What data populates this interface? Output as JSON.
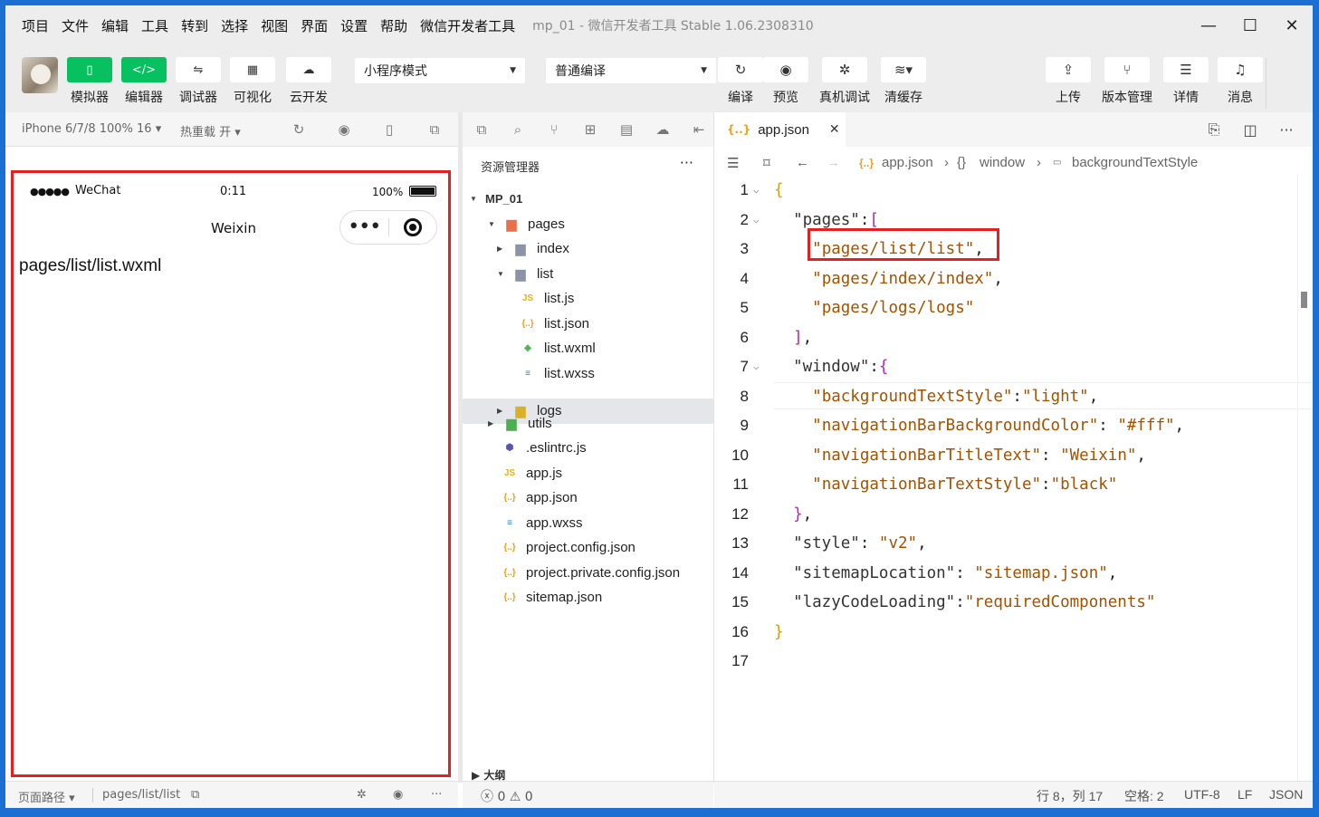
{
  "menu": [
    "项目",
    "文件",
    "编辑",
    "工具",
    "转到",
    "选择",
    "视图",
    "界面",
    "设置",
    "帮助",
    "微信开发者工具"
  ],
  "window_title": "mp_01 - 微信开发者工具 Stable 1.06.2308310",
  "window_controls": {
    "minimize": "—",
    "maximize": "☐",
    "close": "✕"
  },
  "toolbar": {
    "left": [
      {
        "label": "模拟器",
        "icon": "phone-icon",
        "glyph": "▯"
      },
      {
        "label": "编辑器",
        "icon": "code-icon",
        "glyph": "</>"
      },
      {
        "label": "调试器",
        "icon": "debug-icon",
        "glyph": "⇋"
      },
      {
        "label": "可视化",
        "icon": "layout-icon",
        "glyph": "▦"
      },
      {
        "label": "云开发",
        "icon": "cloud-icon",
        "glyph": "☁"
      }
    ],
    "mode_select": "小程序模式",
    "compile_select": "普通编译",
    "middle": [
      {
        "label": "编译",
        "icon": "refresh-icon",
        "glyph": "↻"
      },
      {
        "label": "预览",
        "icon": "eye-icon",
        "glyph": "◉"
      },
      {
        "label": "真机调试",
        "icon": "bug-icon",
        "glyph": "✲"
      },
      {
        "label": "清缓存",
        "icon": "layers-icon",
        "glyph": "≋▾"
      }
    ],
    "right": [
      {
        "label": "上传",
        "icon": "upload-icon",
        "glyph": "⇪"
      },
      {
        "label": "版本管理",
        "icon": "branch-icon",
        "glyph": "⑂"
      },
      {
        "label": "详情",
        "icon": "menu-icon",
        "glyph": "☰"
      },
      {
        "label": "消息",
        "icon": "bell-icon",
        "glyph": "♫"
      }
    ]
  },
  "simulator": {
    "device": "iPhone 6/7/8 100% 16 ▾",
    "hot_reload": "热重载 开 ▾",
    "status": {
      "signal": "●●●●●",
      "carrier": "WeChat",
      "time": "0:11",
      "battery": "100%"
    },
    "nav_title": "Weixin",
    "capsule_dots": "•••",
    "page_text": "pages/list/list.wxml",
    "footer": {
      "path_label": "页面路径 ▾",
      "path": "pages/list/list",
      "more": "···"
    }
  },
  "explorer": {
    "title": "资源管理器",
    "more": "···",
    "tree": [
      {
        "name": "MP_01",
        "depth": 0,
        "arrow": "▼",
        "type": "root"
      },
      {
        "name": "pages",
        "depth": 1,
        "arrow": "▼",
        "type": "folder-red"
      },
      {
        "name": "index",
        "depth": 2,
        "arrow": "▶",
        "type": "folder"
      },
      {
        "name": "list",
        "depth": 2,
        "arrow": "▼",
        "type": "folder-open"
      },
      {
        "name": "list.js",
        "depth": 3,
        "arrow": "",
        "type": "js"
      },
      {
        "name": "list.json",
        "depth": 3,
        "arrow": "",
        "type": "json"
      },
      {
        "name": "list.wxml",
        "depth": 3,
        "arrow": "",
        "type": "wxml"
      },
      {
        "name": "list.wxss",
        "depth": 3,
        "arrow": "",
        "type": "wxss"
      },
      {
        "name": "logs",
        "depth": 2,
        "arrow": "▶",
        "type": "folder-yellow",
        "selected": true
      },
      {
        "name": "utils",
        "depth": 1,
        "arrow": "▶",
        "type": "folder-green"
      },
      {
        "name": ".eslintrc.js",
        "depth": 1,
        "arrow": "",
        "type": "eslint"
      },
      {
        "name": "app.js",
        "depth": 1,
        "arrow": "",
        "type": "js"
      },
      {
        "name": "app.json",
        "depth": 1,
        "arrow": "",
        "type": "json"
      },
      {
        "name": "app.wxss",
        "depth": 1,
        "arrow": "",
        "type": "wxss"
      },
      {
        "name": "project.config.json",
        "depth": 1,
        "arrow": "",
        "type": "json"
      },
      {
        "name": "project.private.config.json",
        "depth": 1,
        "arrow": "",
        "type": "json"
      },
      {
        "name": "sitemap.json",
        "depth": 1,
        "arrow": "",
        "type": "json"
      }
    ],
    "outline": "▶  大纲",
    "problems": "ⓧ 0 ⚠ 0"
  },
  "editor": {
    "tab": "app.json",
    "tab_close": "✕",
    "breadcrumbs": [
      "app.json",
      "window",
      "backgroundTextStyle"
    ],
    "lines": [
      [
        [
          "b1",
          "{"
        ]
      ],
      [
        [
          "k",
          "  \"pages\""
        ],
        [
          "p",
          ":"
        ],
        [
          "b2",
          "["
        ]
      ],
      [
        [
          "k",
          "    "
        ],
        [
          "s",
          "\"pages/list/list\""
        ],
        [
          "p",
          ","
        ]
      ],
      [
        [
          "k",
          "    "
        ],
        [
          "s",
          "\"pages/index/index\""
        ],
        [
          "p",
          ","
        ]
      ],
      [
        [
          "k",
          "    "
        ],
        [
          "s",
          "\"pages/logs/logs\""
        ]
      ],
      [
        [
          "b2",
          "  ]"
        ],
        [
          "p",
          ","
        ]
      ],
      [
        [
          "k",
          "  \"window\""
        ],
        [
          "p",
          ":"
        ],
        [
          "b2",
          "{"
        ]
      ],
      [
        [
          "k",
          "    "
        ],
        [
          "s",
          "\"backgroundTextStyle\""
        ],
        [
          "p",
          ":"
        ],
        [
          "s",
          "\"light\""
        ],
        [
          "p",
          ","
        ]
      ],
      [
        [
          "k",
          "    "
        ],
        [
          "s",
          "\"navigationBarBackgroundColor\""
        ],
        [
          "p",
          ": "
        ],
        [
          "s",
          "\"#fff\""
        ],
        [
          "p",
          ","
        ]
      ],
      [
        [
          "k",
          "    "
        ],
        [
          "s",
          "\"navigationBarTitleText\""
        ],
        [
          "p",
          ": "
        ],
        [
          "s",
          "\"Weixin\""
        ],
        [
          "p",
          ","
        ]
      ],
      [
        [
          "k",
          "    "
        ],
        [
          "s",
          "\"navigationBarTextStyle\""
        ],
        [
          "p",
          ":"
        ],
        [
          "s",
          "\"black\""
        ]
      ],
      [
        [
          "b2",
          "  }"
        ],
        [
          "p",
          ","
        ]
      ],
      [
        [
          "k",
          "  \"style\""
        ],
        [
          "p",
          ": "
        ],
        [
          "s",
          "\"v2\""
        ],
        [
          "p",
          ","
        ]
      ],
      [
        [
          "k",
          "  \"sitemapLocation\""
        ],
        [
          "p",
          ": "
        ],
        [
          "s",
          "\"sitemap.json\""
        ],
        [
          "p",
          ","
        ]
      ],
      [
        [
          "k",
          "  \"lazyCodeLoading\""
        ],
        [
          "p",
          ":"
        ],
        [
          "s",
          "\"requiredComponents\""
        ]
      ],
      [
        [
          "b1",
          "}"
        ]
      ],
      [
        [
          "p",
          ""
        ]
      ]
    ],
    "status": {
      "cursor": "行 8，列 17",
      "indent": "空格: 2",
      "encoding": "UTF-8",
      "eol": "LF",
      "lang": "JSON"
    }
  },
  "colors": {
    "accent_green": "#07c160",
    "highlight_red": "#e52020",
    "string": "#a35200",
    "bracket_yellow": "#d8a000",
    "bracket_purple": "#b329b3",
    "desktop_blue": "#1b6fd3"
  }
}
